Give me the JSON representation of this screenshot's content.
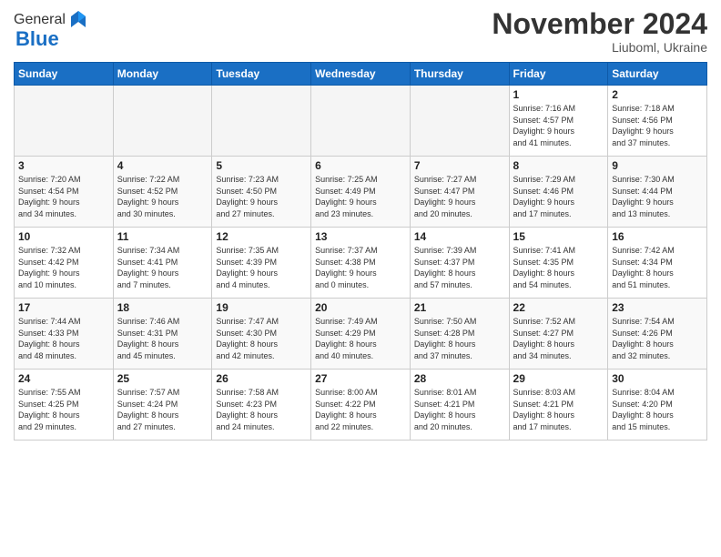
{
  "logo": {
    "general": "General",
    "blue": "Blue"
  },
  "header": {
    "month": "November 2024",
    "location": "Liuboml, Ukraine"
  },
  "weekdays": [
    "Sunday",
    "Monday",
    "Tuesday",
    "Wednesday",
    "Thursday",
    "Friday",
    "Saturday"
  ],
  "weeks": [
    [
      {
        "day": "",
        "info": ""
      },
      {
        "day": "",
        "info": ""
      },
      {
        "day": "",
        "info": ""
      },
      {
        "day": "",
        "info": ""
      },
      {
        "day": "",
        "info": ""
      },
      {
        "day": "1",
        "info": "Sunrise: 7:16 AM\nSunset: 4:57 PM\nDaylight: 9 hours\nand 41 minutes."
      },
      {
        "day": "2",
        "info": "Sunrise: 7:18 AM\nSunset: 4:56 PM\nDaylight: 9 hours\nand 37 minutes."
      }
    ],
    [
      {
        "day": "3",
        "info": "Sunrise: 7:20 AM\nSunset: 4:54 PM\nDaylight: 9 hours\nand 34 minutes."
      },
      {
        "day": "4",
        "info": "Sunrise: 7:22 AM\nSunset: 4:52 PM\nDaylight: 9 hours\nand 30 minutes."
      },
      {
        "day": "5",
        "info": "Sunrise: 7:23 AM\nSunset: 4:50 PM\nDaylight: 9 hours\nand 27 minutes."
      },
      {
        "day": "6",
        "info": "Sunrise: 7:25 AM\nSunset: 4:49 PM\nDaylight: 9 hours\nand 23 minutes."
      },
      {
        "day": "7",
        "info": "Sunrise: 7:27 AM\nSunset: 4:47 PM\nDaylight: 9 hours\nand 20 minutes."
      },
      {
        "day": "8",
        "info": "Sunrise: 7:29 AM\nSunset: 4:46 PM\nDaylight: 9 hours\nand 17 minutes."
      },
      {
        "day": "9",
        "info": "Sunrise: 7:30 AM\nSunset: 4:44 PM\nDaylight: 9 hours\nand 13 minutes."
      }
    ],
    [
      {
        "day": "10",
        "info": "Sunrise: 7:32 AM\nSunset: 4:42 PM\nDaylight: 9 hours\nand 10 minutes."
      },
      {
        "day": "11",
        "info": "Sunrise: 7:34 AM\nSunset: 4:41 PM\nDaylight: 9 hours\nand 7 minutes."
      },
      {
        "day": "12",
        "info": "Sunrise: 7:35 AM\nSunset: 4:39 PM\nDaylight: 9 hours\nand 4 minutes."
      },
      {
        "day": "13",
        "info": "Sunrise: 7:37 AM\nSunset: 4:38 PM\nDaylight: 9 hours\nand 0 minutes."
      },
      {
        "day": "14",
        "info": "Sunrise: 7:39 AM\nSunset: 4:37 PM\nDaylight: 8 hours\nand 57 minutes."
      },
      {
        "day": "15",
        "info": "Sunrise: 7:41 AM\nSunset: 4:35 PM\nDaylight: 8 hours\nand 54 minutes."
      },
      {
        "day": "16",
        "info": "Sunrise: 7:42 AM\nSunset: 4:34 PM\nDaylight: 8 hours\nand 51 minutes."
      }
    ],
    [
      {
        "day": "17",
        "info": "Sunrise: 7:44 AM\nSunset: 4:33 PM\nDaylight: 8 hours\nand 48 minutes."
      },
      {
        "day": "18",
        "info": "Sunrise: 7:46 AM\nSunset: 4:31 PM\nDaylight: 8 hours\nand 45 minutes."
      },
      {
        "day": "19",
        "info": "Sunrise: 7:47 AM\nSunset: 4:30 PM\nDaylight: 8 hours\nand 42 minutes."
      },
      {
        "day": "20",
        "info": "Sunrise: 7:49 AM\nSunset: 4:29 PM\nDaylight: 8 hours\nand 40 minutes."
      },
      {
        "day": "21",
        "info": "Sunrise: 7:50 AM\nSunset: 4:28 PM\nDaylight: 8 hours\nand 37 minutes."
      },
      {
        "day": "22",
        "info": "Sunrise: 7:52 AM\nSunset: 4:27 PM\nDaylight: 8 hours\nand 34 minutes."
      },
      {
        "day": "23",
        "info": "Sunrise: 7:54 AM\nSunset: 4:26 PM\nDaylight: 8 hours\nand 32 minutes."
      }
    ],
    [
      {
        "day": "24",
        "info": "Sunrise: 7:55 AM\nSunset: 4:25 PM\nDaylight: 8 hours\nand 29 minutes."
      },
      {
        "day": "25",
        "info": "Sunrise: 7:57 AM\nSunset: 4:24 PM\nDaylight: 8 hours\nand 27 minutes."
      },
      {
        "day": "26",
        "info": "Sunrise: 7:58 AM\nSunset: 4:23 PM\nDaylight: 8 hours\nand 24 minutes."
      },
      {
        "day": "27",
        "info": "Sunrise: 8:00 AM\nSunset: 4:22 PM\nDaylight: 8 hours\nand 22 minutes."
      },
      {
        "day": "28",
        "info": "Sunrise: 8:01 AM\nSunset: 4:21 PM\nDaylight: 8 hours\nand 20 minutes."
      },
      {
        "day": "29",
        "info": "Sunrise: 8:03 AM\nSunset: 4:21 PM\nDaylight: 8 hours\nand 17 minutes."
      },
      {
        "day": "30",
        "info": "Sunrise: 8:04 AM\nSunset: 4:20 PM\nDaylight: 8 hours\nand 15 minutes."
      }
    ]
  ]
}
